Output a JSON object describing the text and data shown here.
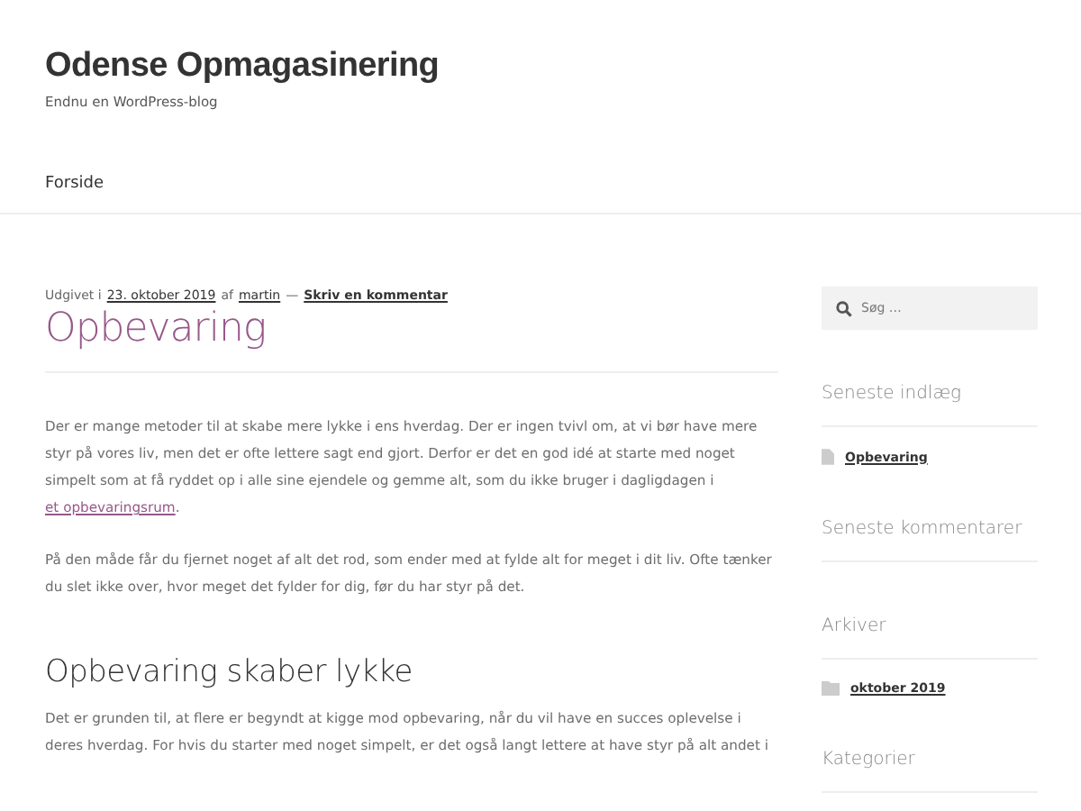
{
  "site": {
    "title": "Odense Opmagasinering",
    "tagline": "Endnu en WordPress-blog"
  },
  "nav": [
    {
      "label": "Forside"
    }
  ],
  "post": {
    "meta": {
      "prefix": "Udgivet i",
      "date": "23. oktober 2019",
      "by": "af",
      "author": "martin",
      "dash": "—",
      "comment_link": "Skriv en kommentar"
    },
    "title": "Opbevaring",
    "blocks": [
      {
        "kind": "paragraph",
        "text": "Der er mange metoder til at skabe mere lykke i ens hverdag. Der er ingen tvivl om, at vi bør have mere styr på vores liv, men det er ofte lettere sagt end gjort. Derfor er det en god idé at starte med noget simpelt som at få ryddet op i alle sine ejendele og gemme alt, som du ikke bruger i dagligdagen i",
        "link": "et opbevaringsrum",
        "after": "."
      },
      {
        "kind": "paragraph",
        "text": "På den måde får du fjernet noget af alt det rod, som ender med at fylde alt for meget i dit liv. Ofte tænker du slet ikke over, hvor meget det fylder for dig, før du har styr på det."
      },
      {
        "kind": "heading",
        "text": "Opbevaring skaber lykke"
      },
      {
        "kind": "paragraph",
        "text": "Det er grunden til, at flere er begyndt at kigge mod opbevaring, når du vil have en succes oplevelse i deres hverdag. For hvis du starter med noget simpelt, er det også langt lettere at have styr på alt andet i"
      }
    ]
  },
  "sidebar": {
    "search": {
      "placeholder": "Søg …"
    },
    "widgets": [
      {
        "title": "Seneste indlæg",
        "items": [
          {
            "kind": "post",
            "label": "Opbevaring"
          }
        ]
      },
      {
        "title": "Seneste kommentarer"
      },
      {
        "title": "Arkiver",
        "items": [
          {
            "kind": "folder",
            "label": "oktober 2019"
          }
        ]
      },
      {
        "title": "Kategorier"
      }
    ]
  }
}
